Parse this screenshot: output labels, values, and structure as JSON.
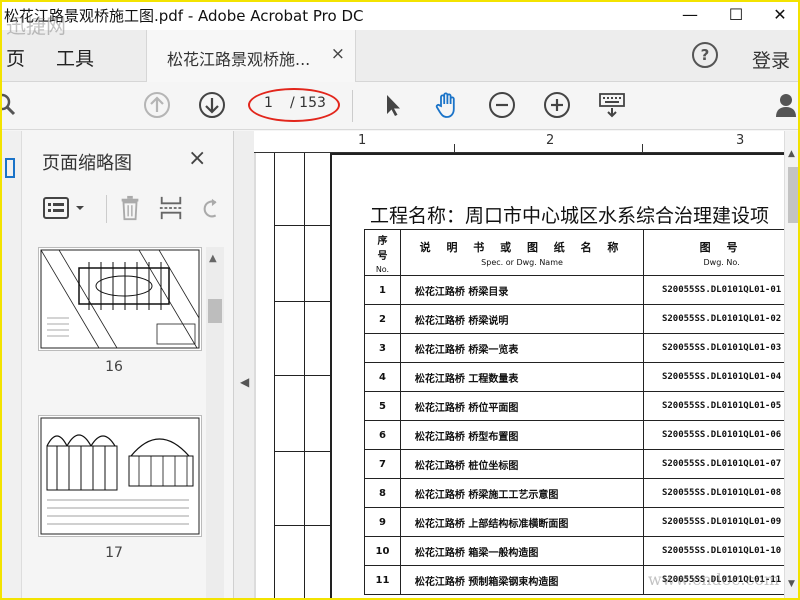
{
  "window": {
    "title": "松花江路景观桥施工图.pdf - Adobe Acrobat Pro DC",
    "minimize": "—",
    "maximize": "☐",
    "close": "✕"
  },
  "watermark": {
    "top_left": "迅捷网",
    "bottom_right": "www.cndoc.com"
  },
  "tabs": {
    "home": "页",
    "tools": "工具",
    "document": "松花江路景观桥施...",
    "document_close": "×",
    "help": "?",
    "login": "登录"
  },
  "toolbar": {
    "icons": [
      "search-icon",
      "page-up-icon",
      "page-down-icon",
      "select-arrow-icon",
      "hand-icon",
      "zoom-out-icon",
      "zoom-in-icon",
      "keyboard-icon",
      "user-icon"
    ],
    "page_current": "1",
    "page_total": "/ 153",
    "highlight_color": "#e2261c"
  },
  "sidebar": {
    "title": "页面缩略图",
    "close": "×",
    "thumbnails": [
      {
        "page": "16"
      },
      {
        "page": "17"
      }
    ]
  },
  "ruler": [
    "1",
    "2",
    "3"
  ],
  "document": {
    "title": "工程名称：周口市中心城区水系综合治理建设项",
    "header": {
      "no": "序号",
      "no_sub": "No.",
      "name": "说 明 书 或 图 纸 名 称",
      "name_sub": "Spec. or Dwg. Name",
      "code": "图 号",
      "code_sub": "Dwg. No."
    },
    "rows": [
      {
        "no": "1",
        "name": "松花江路桥 桥梁目录",
        "code": "S20055SS.DL0101QL01-01"
      },
      {
        "no": "2",
        "name": "松花江路桥 桥梁说明",
        "code": "S20055SS.DL0101QL01-02"
      },
      {
        "no": "3",
        "name": "松花江路桥 桥梁一览表",
        "code": "S20055SS.DL0101QL01-03"
      },
      {
        "no": "4",
        "name": "松花江路桥 工程数量表",
        "code": "S20055SS.DL0101QL01-04"
      },
      {
        "no": "5",
        "name": "松花江路桥 桥位平面图",
        "code": "S20055SS.DL0101QL01-05"
      },
      {
        "no": "6",
        "name": "松花江路桥 桥型布置图",
        "code": "S20055SS.DL0101QL01-06"
      },
      {
        "no": "7",
        "name": "松花江路桥 桩位坐标图",
        "code": "S20055SS.DL0101QL01-07"
      },
      {
        "no": "8",
        "name": "松花江路桥 桥梁施工工艺示意图",
        "code": "S20055SS.DL0101QL01-08"
      },
      {
        "no": "9",
        "name": "松花江路桥 上部结构标准横断面图",
        "code": "S20055SS.DL0101QL01-09"
      },
      {
        "no": "10",
        "name": "松花江路桥 箱梁一般构造图",
        "code": "S20055SS.DL0101QL01-10"
      },
      {
        "no": "11",
        "name": "松花江路桥 预制箱梁钢束构造图",
        "code": "S20055SS.DL0101QL01-11"
      }
    ]
  }
}
